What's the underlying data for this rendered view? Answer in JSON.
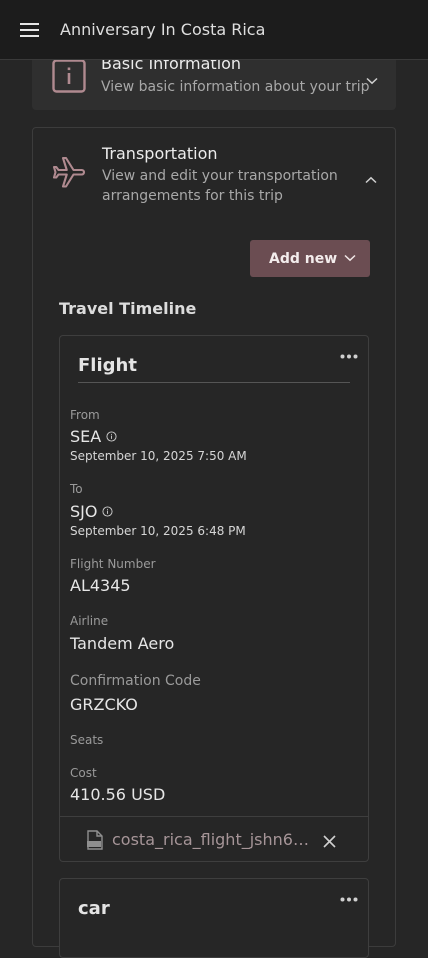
{
  "header": {
    "title": "Anniversary In Costa Rica",
    "menu_icon": "hamburger-menu-icon"
  },
  "sections": {
    "basic": {
      "title": "Basic Information",
      "subtitle": "View basic information about your trip",
      "icon": "info-icon"
    },
    "transportation": {
      "title": "Transportation",
      "subtitle": "View and edit your transportation arrangements for this trip",
      "icon": "airplane-icon",
      "add_button": "Add new",
      "timeline_title": "Travel Timeline"
    }
  },
  "flight": {
    "type": "Flight",
    "from_label": "From",
    "from_code": "SEA",
    "from_time": "September 10, 2025 7:50 AM",
    "to_label": "To",
    "to_code": "SJO",
    "to_time": "September 10, 2025 6:48 PM",
    "flight_number_label": "Flight Number",
    "flight_number": "AL4345",
    "airline_label": "Airline",
    "airline": "Tandem Aero",
    "confirmation_label": "Confirmation Code",
    "confirmation": "GRZCKO",
    "seats_label": "Seats",
    "cost_label": "Cost",
    "cost": "410.56 USD",
    "attachment": "costa_rica_flight_jshn69j..."
  },
  "car": {
    "type": "car"
  },
  "colors": {
    "accent": "#6b4d52",
    "icon_tint": "#b08a90",
    "background": "#262626"
  }
}
